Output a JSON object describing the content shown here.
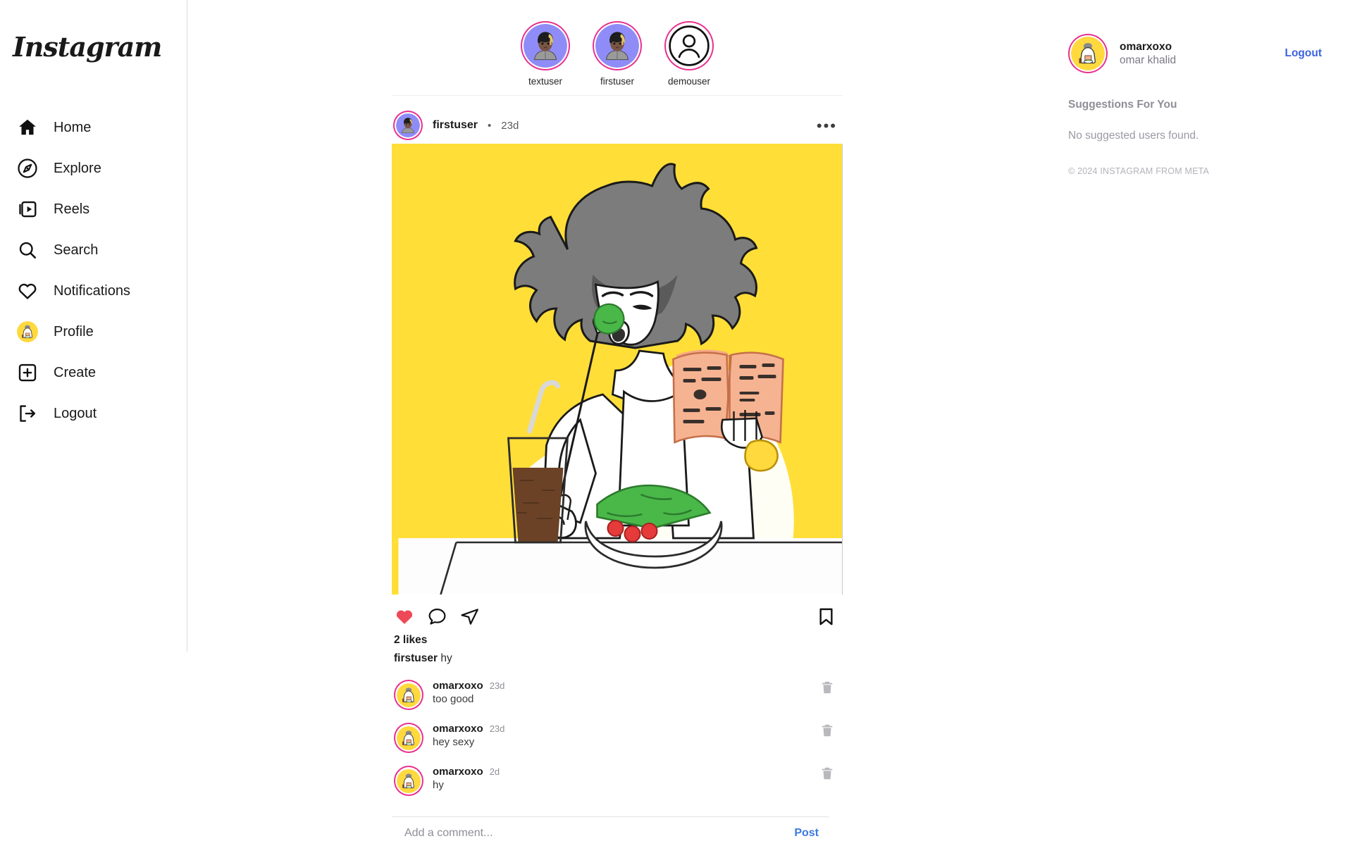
{
  "brand": {
    "name": "Instagram"
  },
  "sidebar": {
    "items": [
      {
        "label": "Home",
        "icon": "home-icon"
      },
      {
        "label": "Explore",
        "icon": "compass-icon"
      },
      {
        "label": "Reels",
        "icon": "reels-icon"
      },
      {
        "label": "Search",
        "icon": "search-icon"
      },
      {
        "label": "Notifications",
        "icon": "heart-icon"
      },
      {
        "label": "Profile",
        "icon": "avatar-icon"
      },
      {
        "label": "Create",
        "icon": "plus-square-icon"
      },
      {
        "label": "Logout",
        "icon": "logout-icon"
      }
    ]
  },
  "stories": [
    {
      "username": "textuser",
      "avatar": "person-purple"
    },
    {
      "username": "firstuser",
      "avatar": "person-purple"
    },
    {
      "username": "demouser",
      "avatar": "default-person"
    }
  ],
  "post": {
    "username": "firstuser",
    "separator": "•",
    "time": "23d",
    "menu_glyph": "•••",
    "likes": "2 likes",
    "caption_user": "firstuser",
    "caption_text": "hy",
    "liked": true,
    "image_alt": "person-eating-salad-reading-book"
  },
  "comments": [
    {
      "username": "omarxoxo",
      "time": "23d",
      "text": "too good"
    },
    {
      "username": "omarxoxo",
      "time": "23d",
      "text": "hey sexy"
    },
    {
      "username": "omarxoxo",
      "time": "2d",
      "text": "hy"
    }
  ],
  "comment_box": {
    "placeholder": "Add a comment...",
    "value": "",
    "post_label": "Post"
  },
  "account": {
    "username": "omarxoxo",
    "fullname": "omar khalid",
    "logout_label": "Logout"
  },
  "suggestions": {
    "title": "Suggestions For You",
    "empty": "No suggested users found."
  },
  "footer": {
    "copyright": "© 2024 INSTAGRAM FROM META"
  },
  "colors": {
    "accent_blue": "#3b62e0",
    "post_blue": "#3b79e0",
    "ring_pink": "#e8318f",
    "like_red": "#ed4956",
    "post_bg_yellow": "#ffde38",
    "muted": "#8e8e96"
  }
}
